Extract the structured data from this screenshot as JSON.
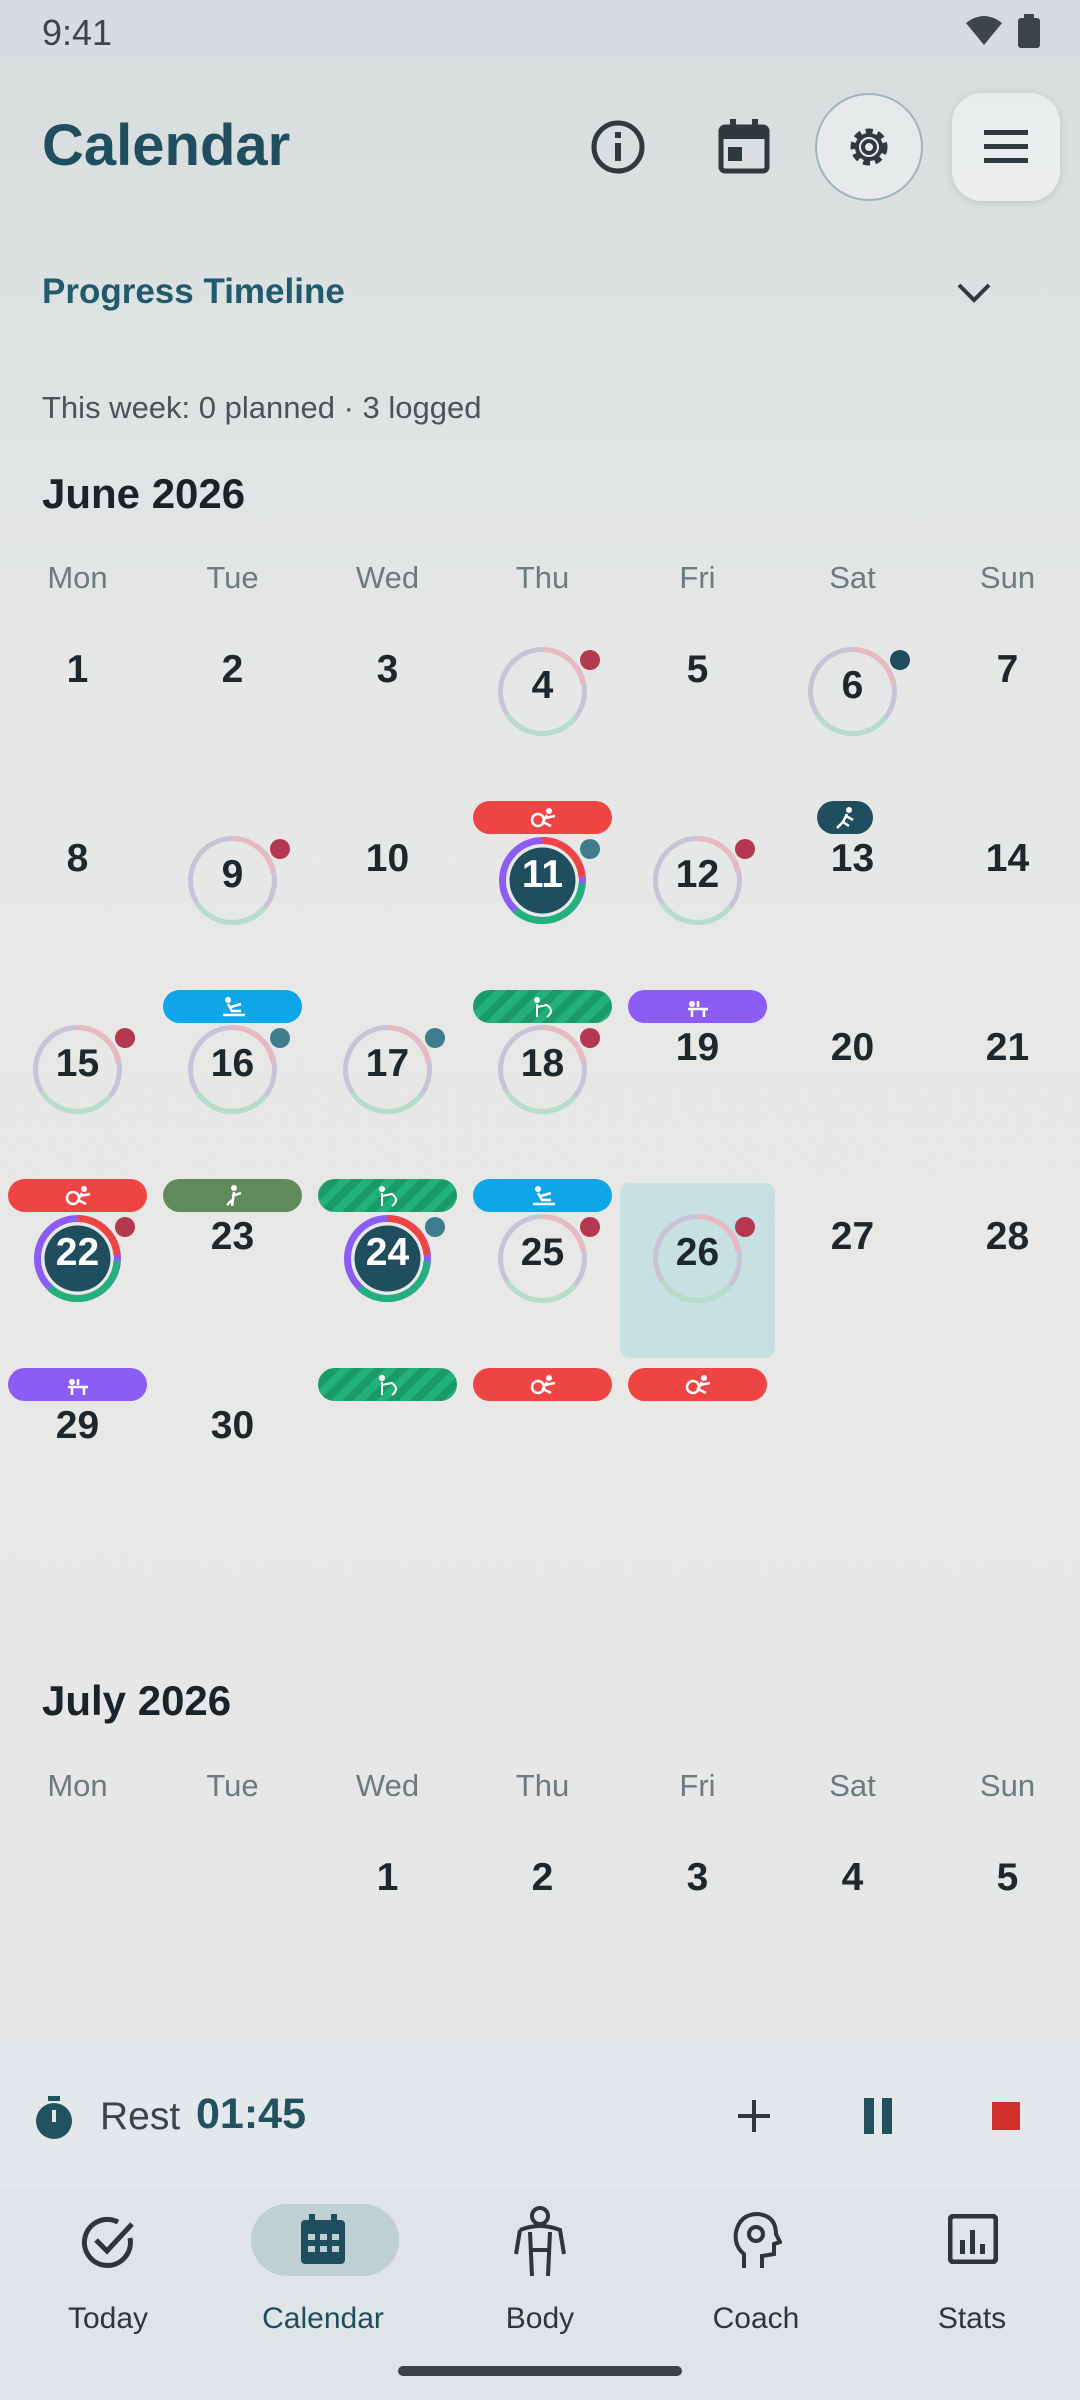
{
  "status": {
    "time": "9:41"
  },
  "header": {
    "title": "Calendar",
    "icons": [
      "info-icon",
      "calendar-icon",
      "gear-icon",
      "menu-icon"
    ]
  },
  "progress": {
    "title": "Progress Timeline"
  },
  "week_summary": "This week: 0 planned · 3 logged",
  "weekdays": [
    "Mon",
    "Tue",
    "Wed",
    "Thu",
    "Fri",
    "Sat",
    "Sun"
  ],
  "june": {
    "title": "June 2026",
    "days": [
      {
        "n": "1"
      },
      {
        "n": "2"
      },
      {
        "n": "3"
      },
      {
        "n": "4",
        "ring": "light",
        "dot": "red",
        "tag": "red",
        "tagIcon": "strength"
      },
      {
        "n": "5"
      },
      {
        "n": "6",
        "ring": "light",
        "dot": "navy",
        "tag": "navy",
        "tagIcon": "run",
        "small": true
      },
      {
        "n": "7"
      },
      {
        "n": "8"
      },
      {
        "n": "9",
        "ring": "light",
        "dot": "red",
        "tag": "blue",
        "tagIcon": "row"
      },
      {
        "n": "10"
      },
      {
        "n": "11",
        "ring": "full",
        "dot": "teal",
        "tag": "stripe",
        "tagIcon": "mobility"
      },
      {
        "n": "12",
        "ring": "light",
        "dot": "red",
        "tag": "purple",
        "tagIcon": "bench"
      },
      {
        "n": "13"
      },
      {
        "n": "14"
      },
      {
        "n": "15",
        "ring": "light",
        "dot": "red",
        "tag": "red",
        "tagIcon": "strength"
      },
      {
        "n": "16",
        "ring": "light",
        "dot": "teal",
        "tag": "green",
        "tagIcon": "stretch"
      },
      {
        "n": "17",
        "ring": "light",
        "dot": "teal",
        "tag": "stripe",
        "tagIcon": "mobility"
      },
      {
        "n": "18",
        "ring": "light",
        "dot": "red",
        "tag": "blue",
        "tagIcon": "row"
      },
      {
        "n": "19"
      },
      {
        "n": "20"
      },
      {
        "n": "21"
      },
      {
        "n": "22",
        "ring": "full",
        "dot": "red",
        "tag": "purple",
        "tagIcon": "bench"
      },
      {
        "n": "23"
      },
      {
        "n": "24",
        "ring": "full",
        "dot": "teal",
        "tag": "stripe",
        "tagIcon": "mobility"
      },
      {
        "n": "25",
        "ring": "light",
        "dot": "red",
        "tag": "red",
        "tagIcon": "strength"
      },
      {
        "n": "26",
        "ring": "light",
        "dot": "red",
        "tag": "red",
        "tagIcon": "strength",
        "today": true
      },
      {
        "n": "27"
      },
      {
        "n": "28"
      },
      {
        "n": "29"
      },
      {
        "n": "30"
      }
    ]
  },
  "july": {
    "title": "July 2026",
    "days": [
      {
        "n": "1"
      },
      {
        "n": "2"
      },
      {
        "n": "3"
      },
      {
        "n": "4"
      },
      {
        "n": "5"
      }
    ]
  },
  "colors": {
    "red": "#ef4444",
    "blue": "#0ea5e9",
    "purple": "#8b5cf6",
    "green": "#5f8a5c",
    "navy": "#1f4e5f",
    "teal": "#3e7d8c",
    "dot_red": "#b4384f"
  },
  "rest": {
    "label": "Rest",
    "time": "01:45"
  },
  "nav": [
    {
      "label": "Today",
      "icon": "check-circle-icon"
    },
    {
      "label": "Calendar",
      "icon": "calendar-icon",
      "active": true
    },
    {
      "label": "Body",
      "icon": "body-icon"
    },
    {
      "label": "Coach",
      "icon": "coach-icon"
    },
    {
      "label": "Stats",
      "icon": "stats-icon"
    }
  ]
}
